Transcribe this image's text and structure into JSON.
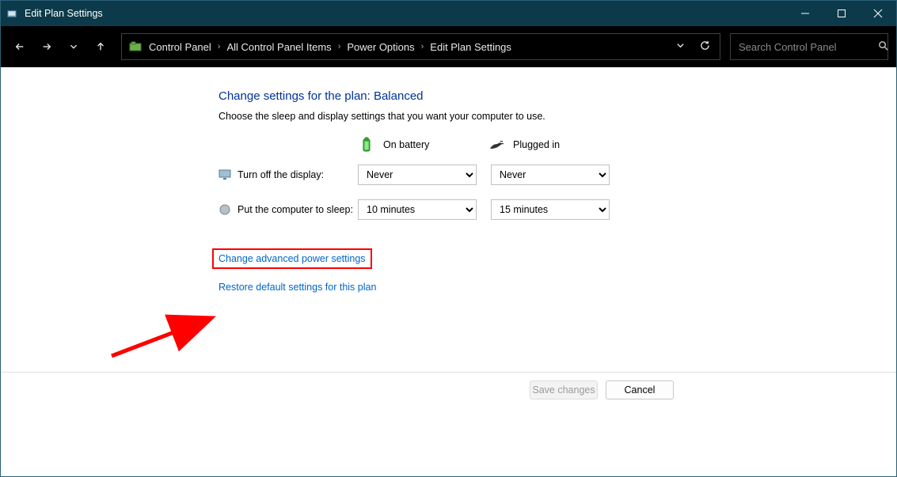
{
  "window": {
    "title": "Edit Plan Settings"
  },
  "breadcrumbs": {
    "items": [
      "Control Panel",
      "All Control Panel Items",
      "Power Options",
      "Edit Plan Settings"
    ]
  },
  "search": {
    "placeholder": "Search Control Panel"
  },
  "page": {
    "heading": "Change settings for the plan: Balanced",
    "subtext": "Choose the sleep and display settings that you want your computer to use.",
    "col_battery": "On battery",
    "col_plugged": "Plugged in",
    "display_label": "Turn off the display:",
    "display_battery_value": "Never",
    "display_plugged_value": "Never",
    "sleep_label": "Put the computer to sleep:",
    "sleep_battery_value": "10 minutes",
    "sleep_plugged_value": "15 minutes",
    "link_advanced": "Change advanced power settings",
    "link_restore": "Restore default settings for this plan",
    "save_button": "Save changes",
    "cancel_button": "Cancel"
  }
}
